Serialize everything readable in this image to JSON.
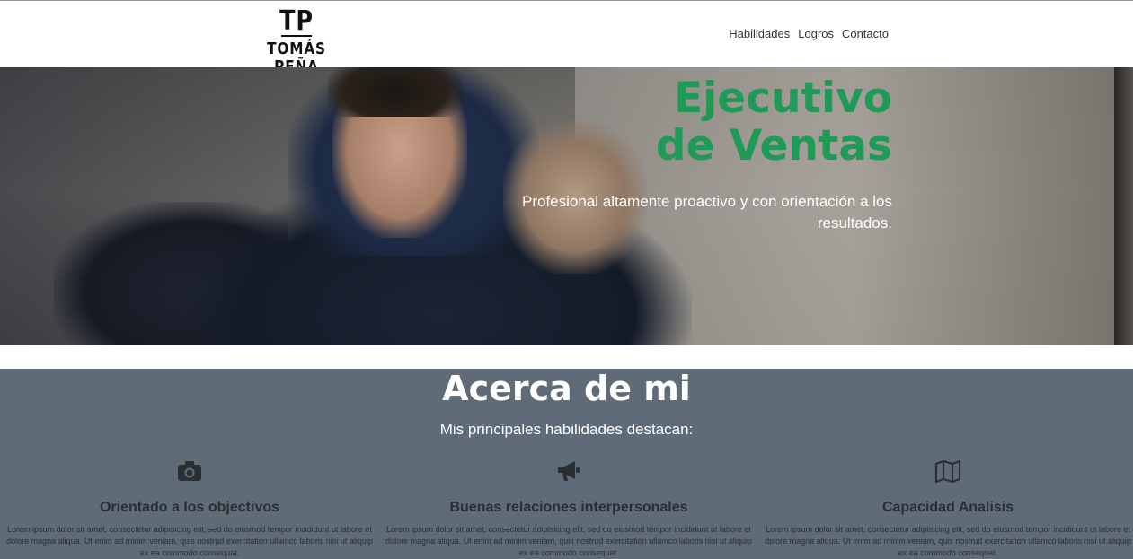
{
  "header": {
    "logo_mark": "TP",
    "logo_name": "TOMÁS PEÑA",
    "nav": [
      "Habilidades",
      "Logros",
      "Contacto"
    ]
  },
  "hero": {
    "title_line1": "Ejecutivo",
    "title_line2": "de Ventas",
    "subtitle": "Profesional altamente proactivo y con orientación a los resultados."
  },
  "about": {
    "title": "Acerca de mi",
    "lead": "Mis principales habilidades destacan:",
    "skills": [
      {
        "icon": "camera-icon",
        "title": "Orientado a los objectivos",
        "text": "Lorem ipsum dolor sit amet, consectetur adipisicing elit, sed do eiusmod tempor incididunt ut labore et dolore magna aliqua. Ut enim ad minim veniam, quis nostrud exercitation ullamco laboris nisi ut aliquip ex ea commodo consequat."
      },
      {
        "icon": "megaphone-icon",
        "title": "Buenas relaciones interpersonales",
        "text": "Lorem ipsum dolor sit amet, consectetur adipisicing elit, sed do eiusmod tempor incididunt ut labore et dolore magna aliqua. Ut enim ad minim veniam, quis nostrud exercitation ullamco laboris nisi ut aliquip ex ea commodo consequat."
      },
      {
        "icon": "map-icon",
        "title": "Capacidad Analisis",
        "text": "Lorem ipsum dolor sit amet, consectetur adipisicing elit, sed do eiusmod tempor incididunt ut labore et dolore magna aliqua. Ut enim ad minim veniam, quis nostrud exercitation ullamco laboris nisi ut aliquip ex ea commodo consequat."
      }
    ]
  },
  "colors": {
    "accent_green": "#1f9a57",
    "about_bg": "#5f6b76",
    "text_dark": "#2b2f33"
  }
}
